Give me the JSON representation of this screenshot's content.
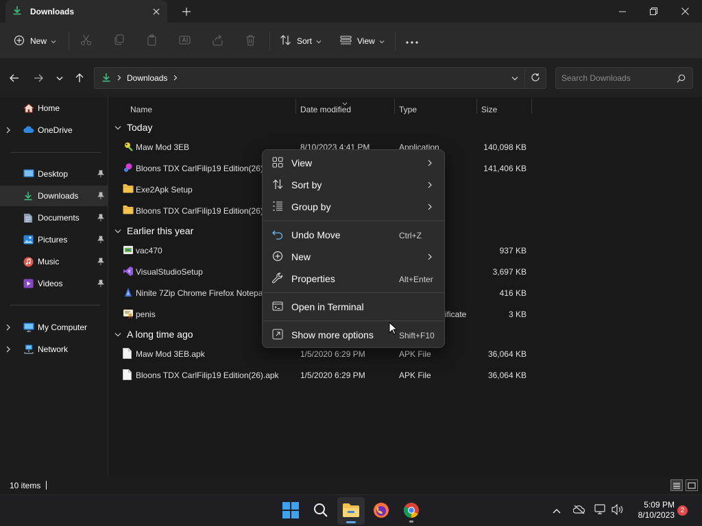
{
  "window": {
    "tab_title": "Downloads"
  },
  "toolbar": {
    "new_label": "New",
    "sort_label": "Sort",
    "view_label": "View"
  },
  "address": {
    "crumb": "Downloads",
    "search_placeholder": "Search Downloads"
  },
  "sidebar": {
    "home": "Home",
    "onedrive": "OneDrive",
    "desktop": "Desktop",
    "downloads": "Downloads",
    "documents": "Documents",
    "pictures": "Pictures",
    "music": "Music",
    "videos": "Videos",
    "my_computer": "My Computer",
    "network": "Network"
  },
  "columns": {
    "name": "Name",
    "date": "Date modified",
    "type": "Type",
    "size": "Size"
  },
  "groups": {
    "today": "Today",
    "earlier": "Earlier this year",
    "long_ago": "A long time ago"
  },
  "files": [
    {
      "name": "Maw Mod 3EB",
      "date": "8/10/2023 4:41 PM",
      "type": "Application",
      "size": "140,098 KB"
    },
    {
      "name": "Bloons TDX CarlFilip19 Edition(26)",
      "date": "",
      "type": "",
      "size": "141,406 KB"
    },
    {
      "name": "Exe2Apk Setup",
      "date": "",
      "type": "",
      "size": ""
    },
    {
      "name": "Bloons TDX CarlFilip19 Edition(26)",
      "date": "",
      "type": "",
      "size": ""
    },
    {
      "name": "vac470",
      "date": "",
      "type": "",
      "size": "937 KB"
    },
    {
      "name": "VisualStudioSetup",
      "date": "",
      "type": "",
      "size": "3,697 KB"
    },
    {
      "name": "Ninite 7Zip Chrome Firefox Notepa",
      "date": "",
      "type": "",
      "size": "416 KB"
    },
    {
      "name": "penis",
      "date": "",
      "type": "ificate",
      "size": "3 KB"
    },
    {
      "name": "Maw Mod 3EB.apk",
      "date": "1/5/2020 6:29 PM",
      "type": "APK File",
      "size": "36,064 KB"
    },
    {
      "name": "Bloons TDX CarlFilip19 Edition(26).apk",
      "date": "1/5/2020 6:29 PM",
      "type": "APK File",
      "size": "36,064 KB"
    }
  ],
  "status": {
    "count": "10 items"
  },
  "context_menu": {
    "view": "View",
    "sort_by": "Sort by",
    "group_by": "Group by",
    "undo_move": "Undo Move",
    "undo_shortcut": "Ctrl+Z",
    "new": "New",
    "properties": "Properties",
    "properties_shortcut": "Alt+Enter",
    "open_terminal": "Open in Terminal",
    "show_more": "Show more options",
    "show_more_shortcut": "Shift+F10"
  },
  "taskbar": {
    "time": "5:09 PM",
    "date": "8/10/2023",
    "notification_count": "2"
  },
  "colors": {
    "accent": "#5ca7e8",
    "download_green": "#3fbf7f",
    "folder_yellow": "#f2c14e",
    "notif_red": "#e04a4a"
  }
}
